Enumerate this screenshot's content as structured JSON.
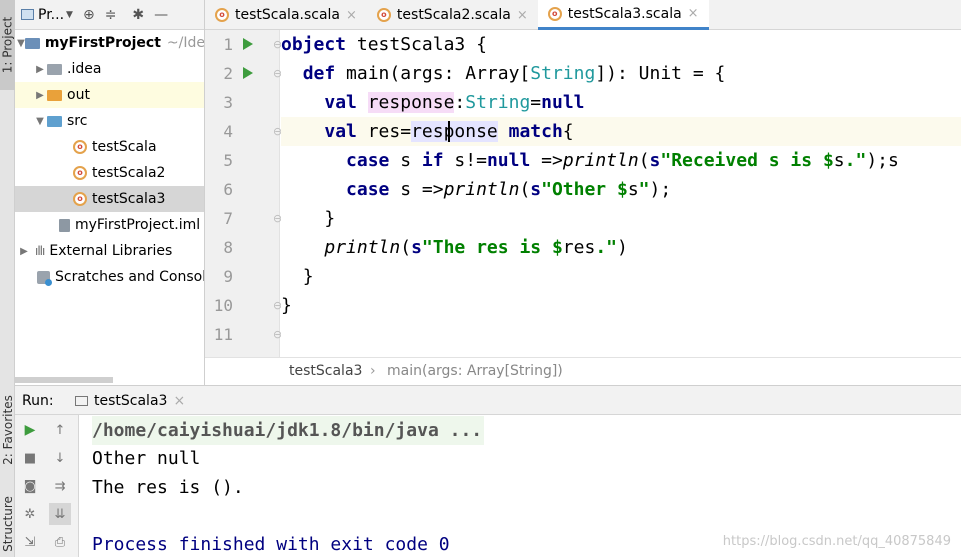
{
  "side_tabs": {
    "project": "1: Project",
    "favorites": "2: Favorites",
    "structure": "Structure"
  },
  "project_panel": {
    "title": "Pr...",
    "tree": [
      {
        "label": "myFirstProject",
        "hint": "~/Ide"
      },
      {
        "label": ".idea"
      },
      {
        "label": "out"
      },
      {
        "label": "src"
      },
      {
        "label": "testScala"
      },
      {
        "label": "testScala2"
      },
      {
        "label": "testScala3"
      },
      {
        "label": "myFirstProject.iml"
      },
      {
        "label": "External Libraries"
      },
      {
        "label": "Scratches and Consoles"
      }
    ]
  },
  "editor_tabs": [
    "testScala.scala",
    "testScala2.scala",
    "testScala3.scala"
  ],
  "line_numbers": [
    "1",
    "2",
    "3",
    "4",
    "5",
    "6",
    "7",
    "8",
    "9",
    "10",
    "11"
  ],
  "code": {
    "l1_kw": "object",
    "l1_rest": " testScala3 {",
    "l2_kw": "def",
    "l2_a": " main(args: Array[",
    "l2_ty": "String",
    "l2_b": "]): Unit = {",
    "l3_kw": "val",
    "l3_var": "response",
    "l3_colon": ":",
    "l3_ty": "String",
    "l3_eq": "=",
    "l3_null": "null",
    "l4_kw": "val",
    "l4_a": " res=",
    "l4_use": "response",
    "l4_match": "match",
    "l4_b": "{",
    "l5_case": "case",
    "l5_a": " s ",
    "l5_if": "if",
    "l5_b": " s!=",
    "l5_null": "null",
    "l5_c": " =>",
    "l5_fn": "println",
    "l5_d": "(",
    "l5_s": "s",
    "l5_str1": "\"Received s is ",
    "l5_dollar": "$",
    "l5_var": "s",
    "l5_str2": ".\"",
    "l5_e": ");s",
    "l6_case": "case",
    "l6_a": " s =>",
    "l6_fn": "println",
    "l6_b": "(",
    "l6_s": "s",
    "l6_str1": "\"Other ",
    "l6_dollar": "$",
    "l6_var": "s",
    "l6_str2": "\"",
    "l6_c": ");",
    "l7": "}",
    "l8_fn": "println",
    "l8_a": "(",
    "l8_s": "s",
    "l8_str1": "\"The res is ",
    "l8_dollar": "$",
    "l8_var": "res",
    "l8_str2": ".\"",
    "l8_b": ")",
    "l9": "}",
    "l10": "}"
  },
  "breadcrumb": {
    "file": "testScala3",
    "method": "main(args: Array[String])"
  },
  "run_panel": {
    "label": "Run:",
    "tab": "testScala3",
    "console": [
      "/home/caiyishuai/jdk1.8/bin/java ...",
      "Other null",
      "The res is ().",
      "Process finished with exit code 0"
    ]
  },
  "watermark": "https://blog.csdn.net/qq_40875849"
}
